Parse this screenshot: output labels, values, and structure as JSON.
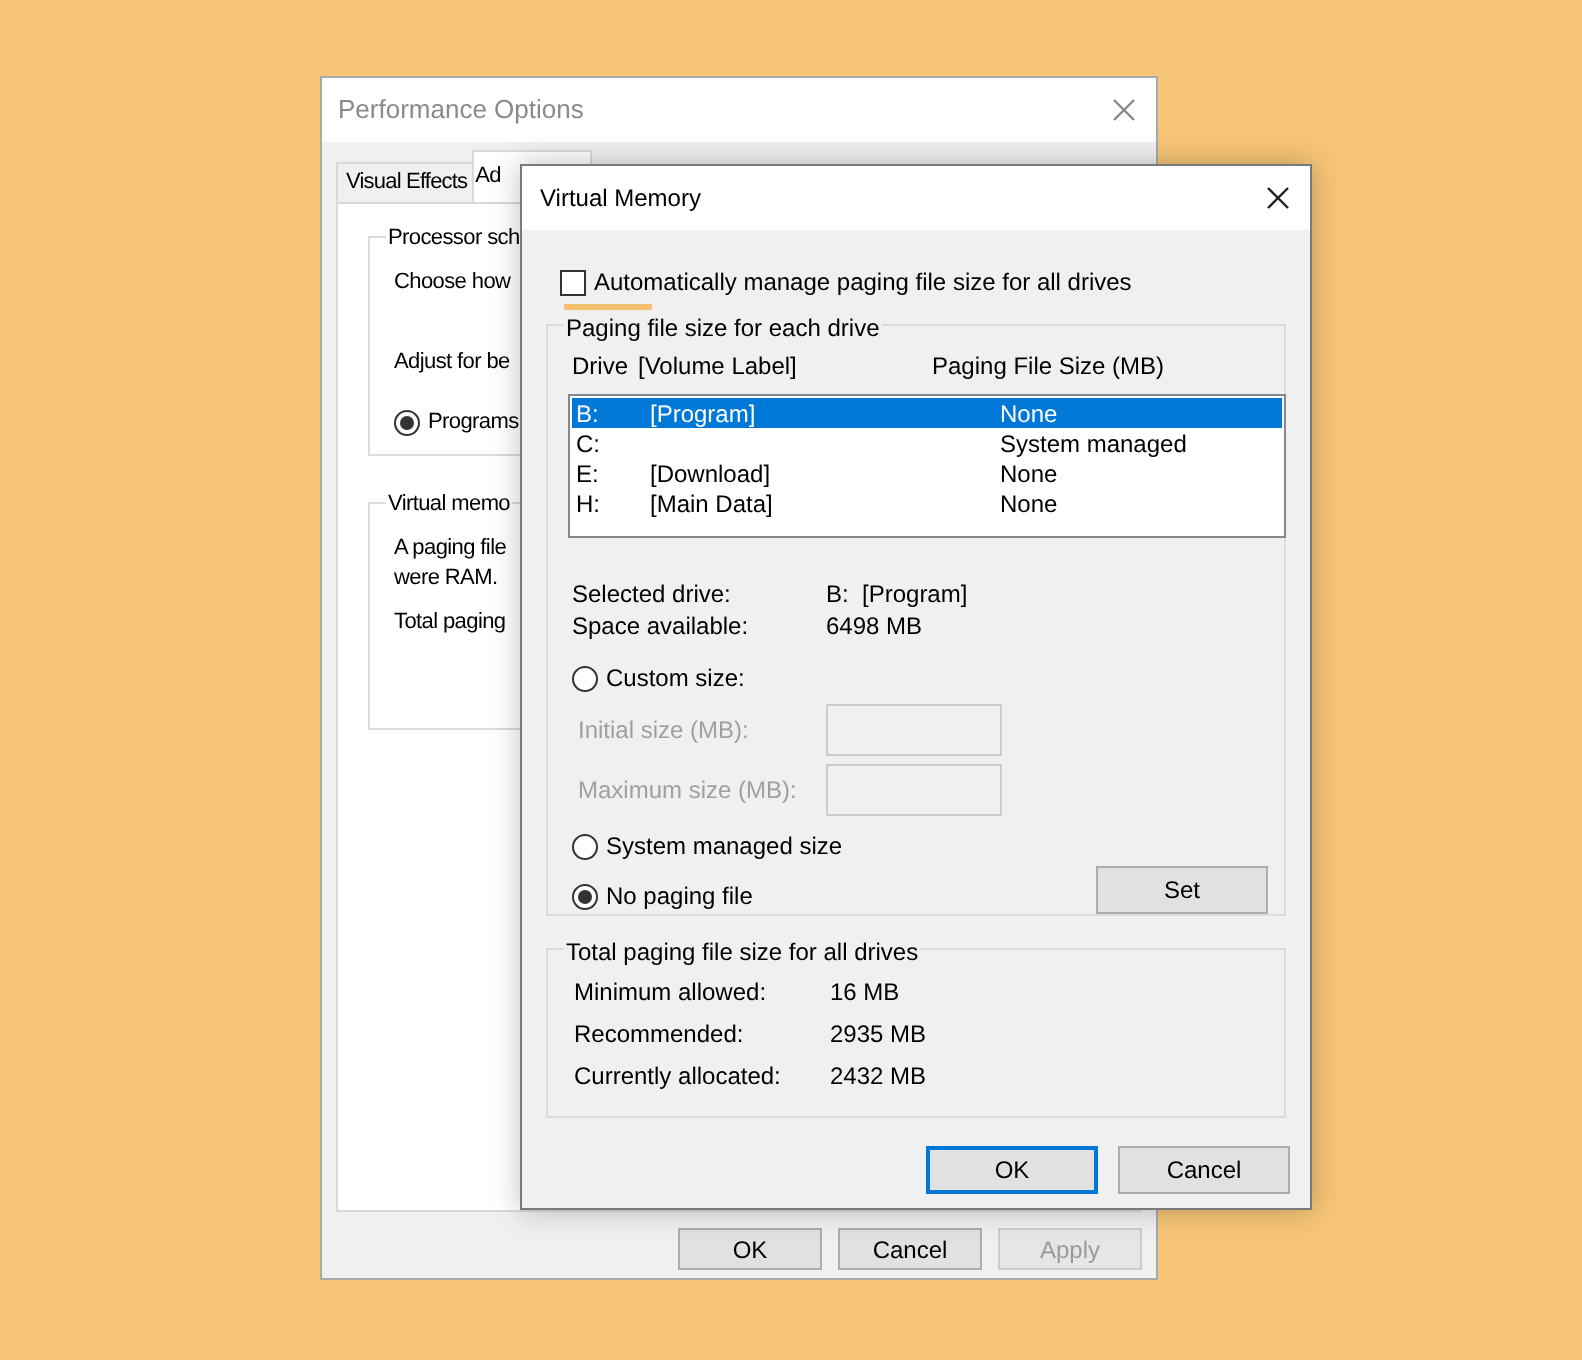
{
  "back_window": {
    "title": "Performance Options",
    "tabs": [
      {
        "label": "Visual Effects",
        "selected": false
      },
      {
        "label": "Ad",
        "selected": true
      }
    ],
    "processor_group": {
      "legend": "Processor sch",
      "lines": [
        "Choose how",
        "Adjust for be"
      ],
      "radio": {
        "label": "Programs",
        "selected": true
      }
    },
    "memory_group": {
      "legend": "Virtual memo",
      "lines": [
        "A paging file",
        "were RAM.",
        "Total paging"
      ]
    },
    "buttons": [
      {
        "label": "OK",
        "disabled": false
      },
      {
        "label": "Cancel",
        "disabled": false
      },
      {
        "label": "Apply",
        "disabled": true
      }
    ]
  },
  "dialog": {
    "title": "Virtual Memory",
    "auto_manage": {
      "label": "Automatically manage paging file size for all drives",
      "checked": false
    },
    "drives_group": {
      "legend": "Paging file size for each drive",
      "columns": [
        "Drive",
        "[Volume Label]",
        "Paging File Size (MB)"
      ],
      "rows": [
        {
          "drive": "B:",
          "label": "[Program]",
          "size": "None",
          "selected": true
        },
        {
          "drive": "C:",
          "label": "",
          "size": "System managed",
          "selected": false
        },
        {
          "drive": "E:",
          "label": "[Download]",
          "size": "None",
          "selected": false
        },
        {
          "drive": "H:",
          "label": "[Main Data]",
          "size": "None",
          "selected": false
        }
      ],
      "info": [
        {
          "label": "Selected drive:",
          "value": "B:  [Program]"
        },
        {
          "label": "Space available:",
          "value": "6498 MB"
        }
      ],
      "size_options": [
        {
          "label": "Custom size:",
          "selected": false
        },
        {
          "label": "System managed size",
          "selected": false
        },
        {
          "label": "No paging file",
          "selected": true
        }
      ],
      "size_fields": [
        {
          "label": "Initial size (MB):",
          "disabled": true
        },
        {
          "label": "Maximum size (MB):",
          "disabled": true
        }
      ],
      "set_button": "Set"
    },
    "totals_group": {
      "legend": "Total paging file size for all drives",
      "rows": [
        {
          "label": "Minimum allowed:",
          "value": "16 MB"
        },
        {
          "label": "Recommended:",
          "value": "2935 MB"
        },
        {
          "label": "Currently allocated:",
          "value": "2432 MB"
        }
      ]
    },
    "buttons": [
      {
        "label": "OK",
        "default": true
      },
      {
        "label": "Cancel",
        "default": false
      }
    ]
  }
}
